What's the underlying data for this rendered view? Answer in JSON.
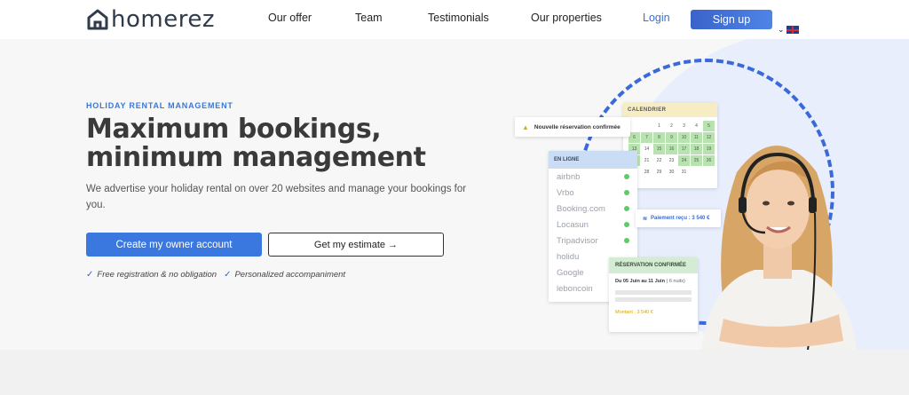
{
  "brand": {
    "logo_text": "homerez"
  },
  "nav": {
    "links": [
      "Our offer",
      "Team",
      "Testimonials",
      "Our properties"
    ],
    "login": "Login",
    "signup": "Sign up",
    "language": "en-flag-icon"
  },
  "hero": {
    "eyebrow": "HOLIDAY RENTAL MANAGEMENT",
    "headline_line1": "Maximum bookings,",
    "headline_line2": "minimum management",
    "subtitle": "We advertise your holiday rental on over 20 websites and manage your bookings for you.",
    "cta_primary": "Create my owner account",
    "cta_secondary": "Get my estimate →",
    "perks": [
      "Free registration & no obligation",
      "Personalized accompaniment"
    ]
  },
  "illustration": {
    "notification": "Nouvelle réservation confirmée",
    "calendar_title": "CALENDRIER",
    "calendar_days": [
      "",
      "",
      "1",
      "2",
      "3",
      "4",
      "5",
      "6",
      "7",
      "8",
      "9",
      "10",
      "11",
      "12",
      "13",
      "14",
      "15",
      "16",
      "17",
      "18",
      "19",
      "20",
      "21",
      "22",
      "23",
      "24",
      "25",
      "26",
      "27",
      "28",
      "29",
      "30",
      "31",
      "",
      "",
      ""
    ],
    "online_title": "EN LIGNE",
    "sites": [
      "airbnb",
      "Vrbo",
      "Booking.com",
      "Locasun",
      "Tripadvisor",
      "holidu",
      "Google",
      "leboncoin"
    ],
    "payment": "Paiement reçu : 3 540 €",
    "reservation_title": "RÉSERVATION CONFIRMÉE",
    "reservation_dates": "Du 05 Juin au 11 Juin",
    "reservation_nights": "( 6 nuits)",
    "reservation_amount": "Montant : 3 540 €"
  },
  "colors": {
    "accent": "#3a78e0",
    "text_dark": "#3a3a3a",
    "dash_ring": "#3a6ad8"
  }
}
